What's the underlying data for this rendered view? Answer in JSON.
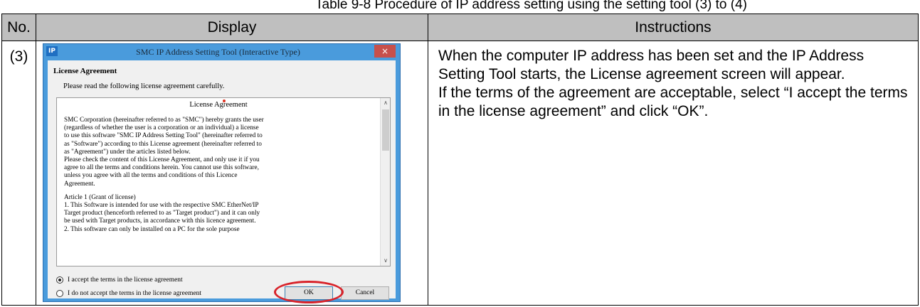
{
  "page_header": "Table 9-8 Procedure of IP address setting using the setting tool (3) to (4)",
  "table": {
    "headers": {
      "no": "No.",
      "display": "Display",
      "instructions": "Instructions"
    },
    "row": {
      "no": "(3)",
      "instructions": [
        "When the computer IP address has been set and the IP Address Setting Tool starts, the License agreement screen will appear.",
        "If the terms of the agreement are acceptable, select “I accept the terms in the license agreement” and click “OK”."
      ]
    }
  },
  "dialog": {
    "app_icon": "IP",
    "title": "SMC IP Address Setting Tool (Interactive Type)",
    "close_glyph": "×",
    "heading": "License Agreement",
    "prompt": "Please read the following license agreement carefully.",
    "license_title": "License Agreement",
    "license_lines": [
      " SMC Corporation (hereinafter referred to as \"SMC\") hereby grants the user",
      "(regardless of whether the user is a corporation or an individual) a license",
      "to use this software \"SMC IP Address Setting Tool\" (hereinafter referred to",
      "as \"Software\") according to this License agreement (hereinafter referred to",
      "as \"Agreement\") under the articles listed below.",
      " Please check the content of this License Agreement, and only use it if you",
      "agree to all the terms and conditions herein. You cannot use this software,",
      "unless you agree with all the terms and conditions of this Licence",
      "Agreement.",
      "",
      "Article 1 (Grant of license)",
      " 1. This Software is intended for use with the respective SMC EtherNet/IP",
      "Target product (henceforth referred to as \"Target product\") and it can only",
      "be used with Target products, in accordance with this licence agreement.",
      " 2. This software can only be installed on a PC for the sole purpose"
    ],
    "scroll_up": "∧",
    "scroll_down": "∨",
    "accept_label": "I accept the terms in the license agreement",
    "decline_label": "I do not accept the terms in the license agreement",
    "accept_selected": true,
    "ok_label": "OK",
    "cancel_label": "Cancel",
    "highlight_color": "#d8232a"
  }
}
